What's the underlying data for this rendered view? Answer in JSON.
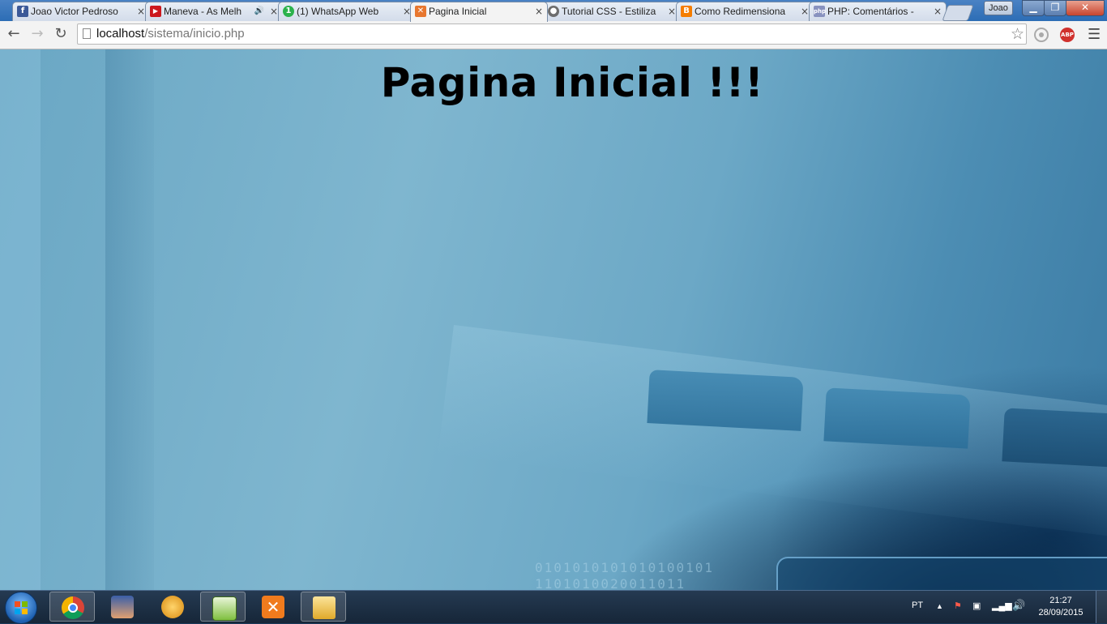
{
  "browser": {
    "tabs": [
      {
        "title": "Joao Victor Pedroso",
        "icon": "facebook-icon",
        "color": "#3b5998",
        "glyph": "f"
      },
      {
        "title": "Maneva - As Melh",
        "icon": "youtube-icon",
        "color": "#cc181e",
        "glyph": "▶",
        "audio": "🔊"
      },
      {
        "title": "(1) WhatsApp Web",
        "icon": "whatsapp-icon",
        "color": "#2bb24c",
        "glyph": "1"
      },
      {
        "title": "Pagina Inicial",
        "icon": "xampp-icon",
        "color": "#e8772e",
        "glyph": "✕",
        "active": true
      },
      {
        "title": "Tutorial CSS - Estiliza",
        "icon": "site-icon",
        "color": "#6d6d6d",
        "glyph": "●"
      },
      {
        "title": "Como Redimensiona",
        "icon": "blogger-icon",
        "color": "#f57d00",
        "glyph": "B"
      },
      {
        "title": "PHP: Comentários -",
        "icon": "php-icon",
        "color": "#8892bf",
        "glyph": "php"
      }
    ],
    "close_glyph": "×",
    "profile_name": "Joao",
    "url_host": "localhost",
    "url_path": "/sistema/inicio.php",
    "abp_label": "ABP"
  },
  "page": {
    "heading": "Pagina Inicial !!!",
    "binary_line1": "0101010101010100101",
    "binary_line2": "1101010020011011"
  },
  "taskbar": {
    "language": "PT",
    "time": "21:27",
    "date": "28/09/2015",
    "apps": [
      {
        "name": "chrome-icon",
        "color": "#db4437"
      },
      {
        "name": "game-character-icon",
        "color": "#3a5fa8"
      },
      {
        "name": "fl-studio-icon",
        "color": "#f0a020"
      },
      {
        "name": "notepad-icon",
        "color": "#7fbf3f"
      },
      {
        "name": "xampp-icon",
        "color": "#f07b1d"
      },
      {
        "name": "file-explorer-icon",
        "color": "#f2c94c"
      }
    ]
  }
}
